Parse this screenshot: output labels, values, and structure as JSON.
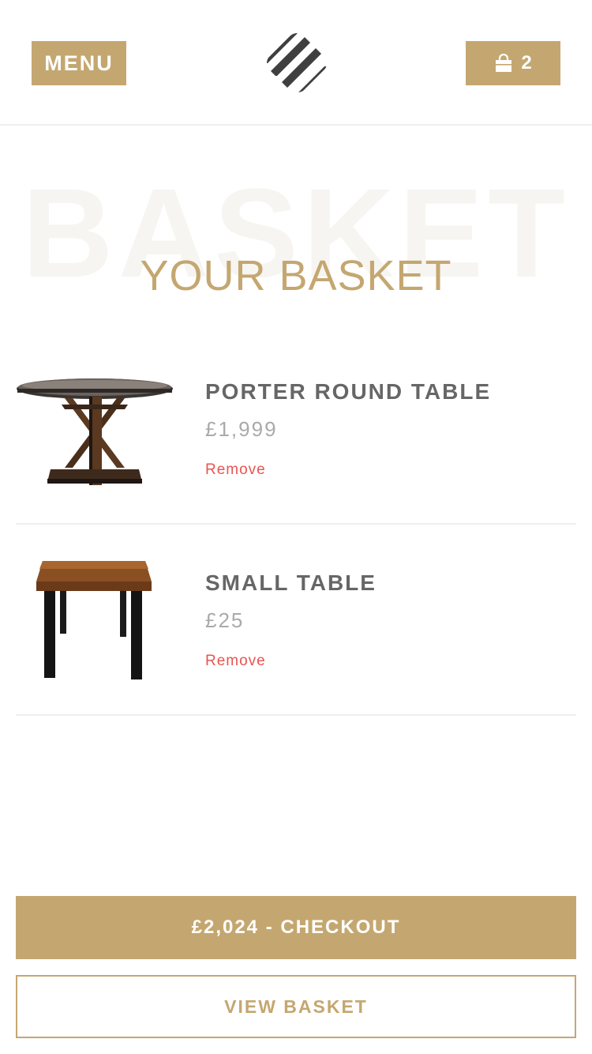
{
  "header": {
    "menu_label": "MENU",
    "cart_count": "2",
    "icons": {
      "logo": "brand-logo-icon",
      "cart": "shopping-bag-icon"
    }
  },
  "page": {
    "watermark": "BASKET",
    "title": "YOUR BASKET"
  },
  "items": [
    {
      "name": "PORTER ROUND TABLE",
      "price": "£1,999",
      "remove_label": "Remove",
      "image": "round-table-image"
    },
    {
      "name": "SMALL TABLE",
      "price": "£25",
      "remove_label": "Remove",
      "image": "small-table-image"
    }
  ],
  "actions": {
    "checkout_label": "£2,024 - CHECKOUT",
    "view_basket_label": "VIEW BASKET"
  },
  "colors": {
    "accent": "#c4a770",
    "remove": "#e85450",
    "logo": "#3f3f3f"
  }
}
